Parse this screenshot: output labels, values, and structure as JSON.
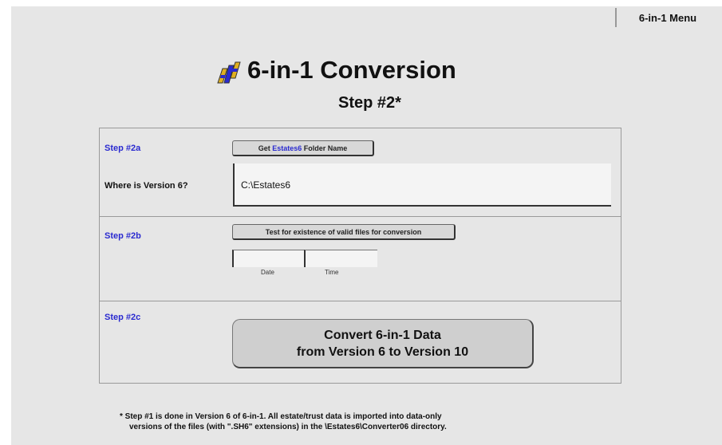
{
  "menu": {
    "label": "6-in-1 Menu"
  },
  "header": {
    "title": "6-in-1 Conversion",
    "subtitle": "Step #2*",
    "logo_icon": "6-in-1-logo-icon"
  },
  "step2a": {
    "label": "Step #2a",
    "button": {
      "prefix": "Get ",
      "highlight": "Estates6",
      "suffix": " Folder Name"
    },
    "field_label": "Where is Version 6?",
    "field_value": "C:\\Estates6"
  },
  "step2b": {
    "label": "Step #2b",
    "button_label": "Test for existence of valid files for conversion",
    "date_label": "Date",
    "time_label": "Time"
  },
  "step2c": {
    "label": "Step #2c",
    "button_line1": "Convert 6-in-1 Data",
    "button_line2": "from Version 6 to Version 10"
  },
  "footnote": {
    "line1": "* Step #1 is done in Version 6 of 6-in-1.  All estate/trust data is imported into data-only",
    "line2": "versions of the files (with \".SH6\" extensions) in the \\Estates6\\Converter06 directory."
  },
  "colors": {
    "accent": "#2a2ad0",
    "background": "#e6e6e6"
  }
}
